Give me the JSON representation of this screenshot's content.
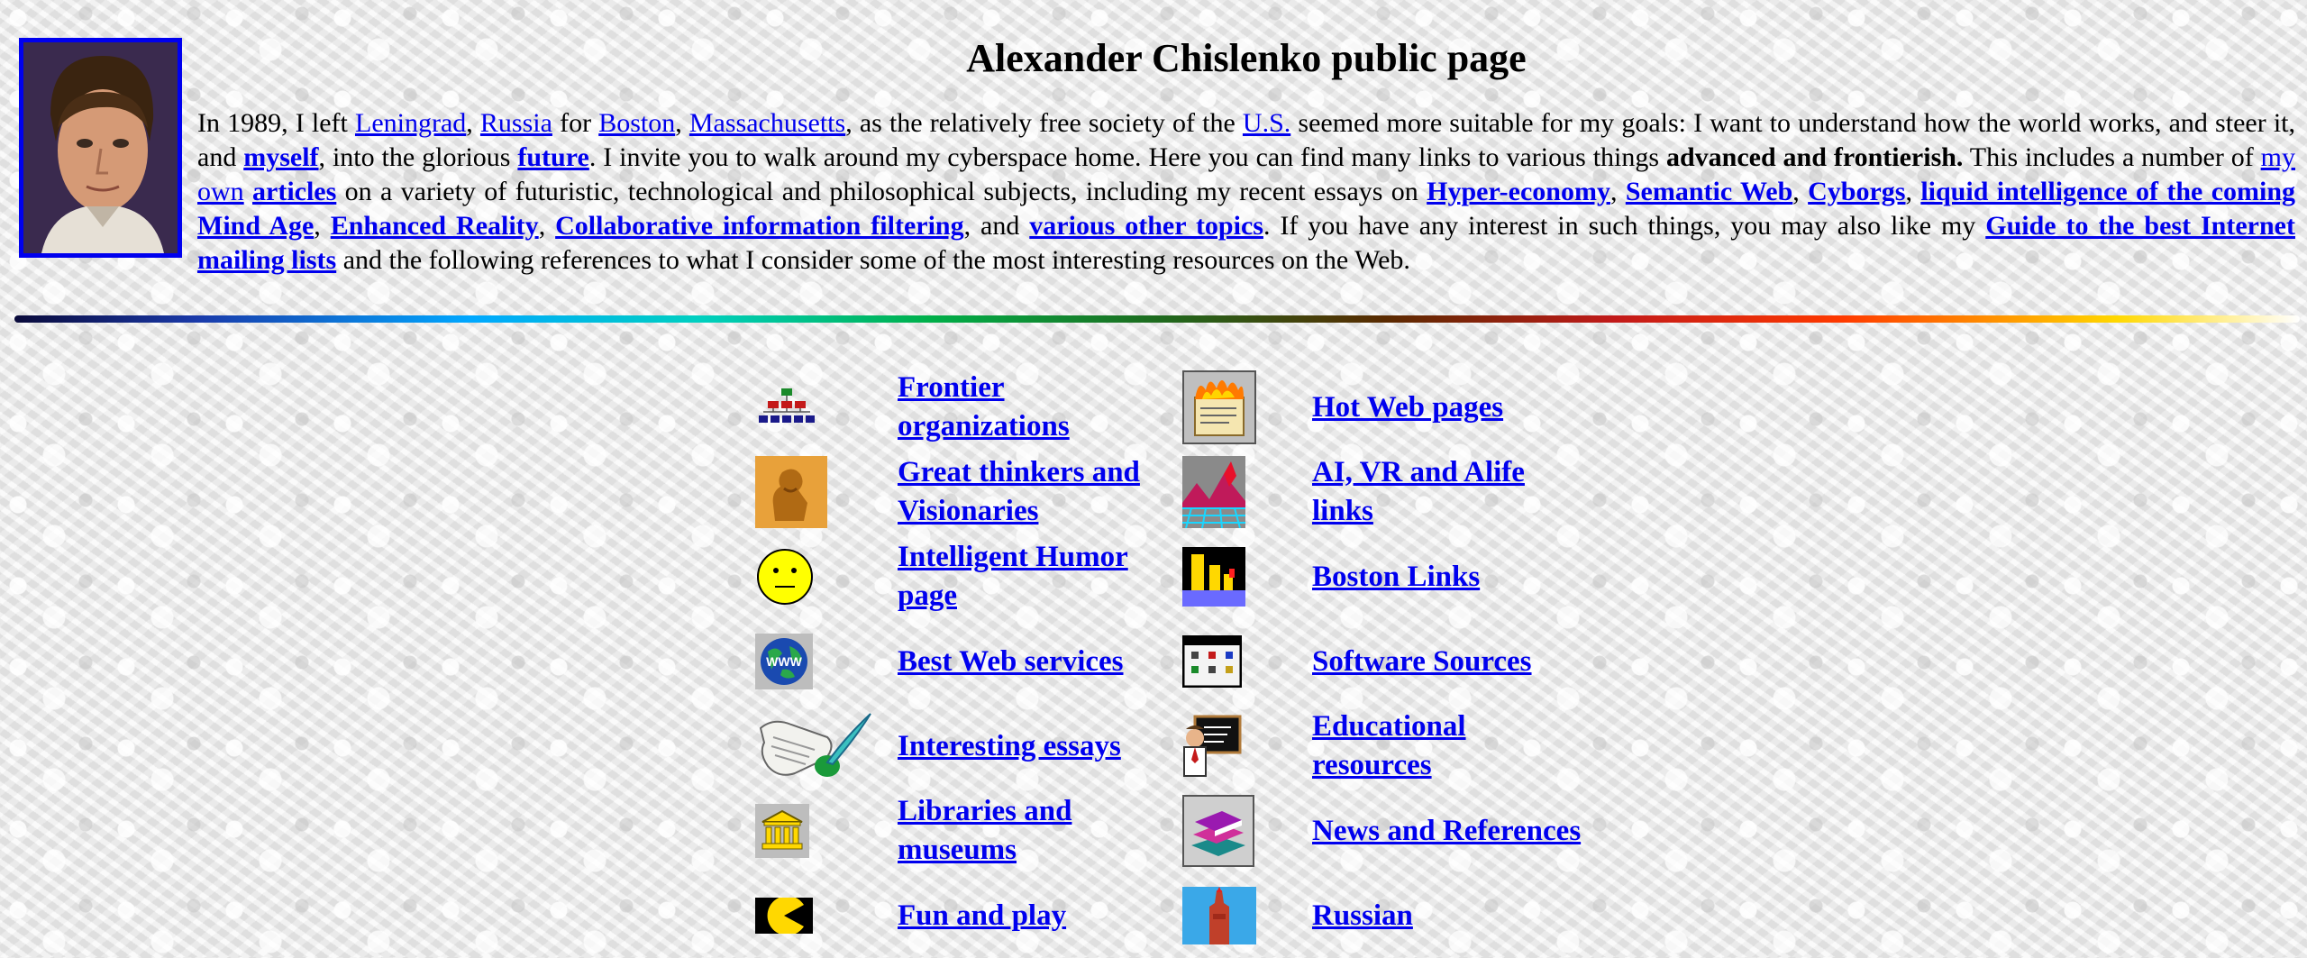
{
  "page": {
    "title": "Alexander Chislenko public page"
  },
  "intro": {
    "segments": [
      {
        "type": "text",
        "text": "In 1989, I left "
      },
      {
        "type": "link",
        "text": "Leningrad"
      },
      {
        "type": "text",
        "text": ", "
      },
      {
        "type": "link",
        "text": "Russia"
      },
      {
        "type": "text",
        "text": " for "
      },
      {
        "type": "link",
        "text": "Boston"
      },
      {
        "type": "text",
        "text": ", "
      },
      {
        "type": "link",
        "text": "Massachusetts"
      },
      {
        "type": "text",
        "text": ", as the relatively free society of the "
      },
      {
        "type": "link",
        "text": "U.S."
      },
      {
        "type": "text",
        "text": " seemed more suitable for my goals: I want to understand how the world works, and steer it, and "
      },
      {
        "type": "link",
        "text": "myself",
        "bold": true
      },
      {
        "type": "text",
        "text": ", into the glorious "
      },
      {
        "type": "link",
        "text": "future",
        "bold": true
      },
      {
        "type": "text",
        "text": ". I invite you to walk around my cyberspace home. Here you can find many links to various things "
      },
      {
        "type": "bold",
        "text": "advanced and frontierish."
      },
      {
        "type": "text",
        "text": " This includes a number of "
      },
      {
        "type": "link",
        "text": "my own"
      },
      {
        "type": "text",
        "text": " "
      },
      {
        "type": "link",
        "text": "articles",
        "bold": true
      },
      {
        "type": "text",
        "text": " on a variety of futuristic, technological and philosophical subjects, including my recent essays on "
      },
      {
        "type": "link",
        "text": "Hyper-economy",
        "bold": true
      },
      {
        "type": "text",
        "text": ", "
      },
      {
        "type": "link",
        "text": "Semantic Web",
        "bold": true
      },
      {
        "type": "text",
        "text": ", "
      },
      {
        "type": "link",
        "text": "Cyborgs",
        "bold": true
      },
      {
        "type": "text",
        "text": ", "
      },
      {
        "type": "link",
        "text": "liquid intelligence of the coming Mind Age",
        "bold": true
      },
      {
        "type": "text",
        "text": ", "
      },
      {
        "type": "link",
        "text": "Enhanced Reality",
        "bold": true
      },
      {
        "type": "text",
        "text": ", "
      },
      {
        "type": "link",
        "text": "Collaborative information filtering",
        "bold": true
      },
      {
        "type": "text",
        "text": ", and "
      },
      {
        "type": "link",
        "text": "various other topics",
        "bold": true
      },
      {
        "type": "text",
        "text": ". If you have any interest in such things, you may also like my "
      },
      {
        "type": "link",
        "text": "Guide to the best Internet mailing lists",
        "bold": true
      },
      {
        "type": "text",
        "text": " and the following references to what I consider some of the most interesting resources on the Web."
      }
    ]
  },
  "links": {
    "rows": [
      {
        "left": {
          "label": "Frontier organizations",
          "icon": "organization-chart-icon"
        },
        "right": {
          "label": "Hot Web pages",
          "icon": "burning-scroll-icon"
        }
      },
      {
        "left": {
          "label": "Great thinkers and Visionaries",
          "icon": "thinker-statue-icon"
        },
        "right": {
          "label": "AI, VR and Alife links",
          "icon": "vr-landscape-icon"
        }
      },
      {
        "left": {
          "label": "Intelligent Humor page",
          "icon": "smiley-face-icon"
        },
        "right": {
          "label": "Boston Links",
          "icon": "boston-skyline-icon"
        }
      },
      {
        "left": {
          "label": "Best Web services",
          "icon": "www-globe-icon"
        },
        "right": {
          "label": "Software Sources",
          "icon": "software-window-icon"
        }
      },
      {
        "left": {
          "label": "Interesting essays",
          "icon": "quill-scroll-icon"
        },
        "right": {
          "label": "Educational resources",
          "icon": "teacher-blackboard-icon"
        }
      },
      {
        "left": {
          "label": "Libraries and museums",
          "icon": "museum-building-icon"
        },
        "right": {
          "label": "News and References",
          "icon": "stack-of-books-icon"
        }
      },
      {
        "left": {
          "label": "Fun and play",
          "icon": "pacman-icon"
        },
        "right": {
          "label": "Russian",
          "icon": "russian-tower-icon"
        }
      }
    ]
  },
  "colors": {
    "link": "#0000ee",
    "portrait_border": "#0000ee"
  }
}
